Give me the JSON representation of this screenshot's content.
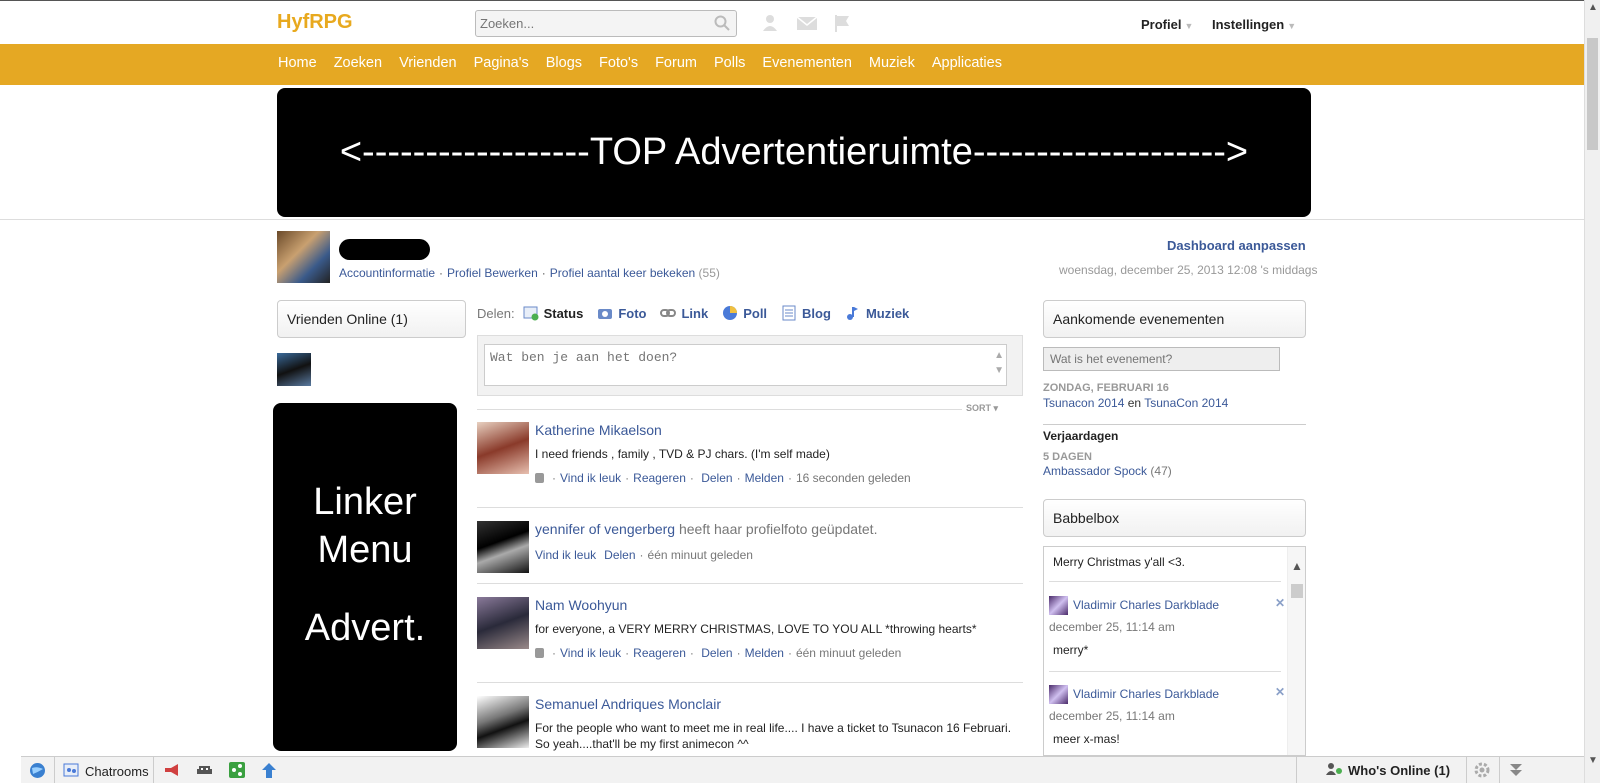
{
  "topbar": {
    "logo": "HyfRPG",
    "search_placeholder": "Zoeken...",
    "profile_label": "Profiel",
    "settings_label": "Instellingen"
  },
  "nav": {
    "items": [
      "Home",
      "Zoeken",
      "Vrienden",
      "Pagina's",
      "Blogs",
      "Foto's",
      "Forum",
      "Polls",
      "Evenementen",
      "Muziek",
      "Applicaties"
    ]
  },
  "banner": {
    "text": "<------------------TOP Advertentieruimte-------------------->"
  },
  "profile": {
    "links": [
      "Accountinformatie",
      "Profiel Bewerken",
      "Profiel aantal keer bekeken"
    ],
    "view_count": "(55)",
    "dashboard_link": "Dashboard aanpassen",
    "datetime": "woensdag, december 25, 2013 12:08 's middags"
  },
  "left": {
    "friends_header": "Vrienden Online (1)",
    "ad_line1": "Linker",
    "ad_line2": "Menu",
    "ad_line3": "Advert."
  },
  "share": {
    "label": "Delen:",
    "items": [
      "Status",
      "Foto",
      "Link",
      "Poll",
      "Blog",
      "Muziek"
    ],
    "placeholder": "Wat ben je aan het doen?",
    "sort": "SORT"
  },
  "feed": [
    {
      "author": "Katherine Mikaelson",
      "action": "",
      "text": "I need friends , family , TVD & PJ chars. (I'm self made)",
      "like": "Vind ik leuk",
      "reply": "Reageren",
      "share": "Delen",
      "report": "Melden",
      "time": "16 seconden geleden"
    },
    {
      "author": "yennifer of vengerberg",
      "action": "heeft haar profielfoto geüpdatet.",
      "like": "Vind ik leuk",
      "share": "Delen",
      "time": "één minuut geleden"
    },
    {
      "author": "Nam Woohyun",
      "action": "",
      "text": "for everyone, a VERY MERRY CHRISTMAS, LOVE TO YOU ALL *throwing hearts*",
      "like": "Vind ik leuk",
      "reply": "Reageren",
      "share": "Delen",
      "report": "Melden",
      "time": "één minuut geleden"
    },
    {
      "author": "Semanuel Andriques Monclair",
      "action": "",
      "text": "For the people who want to meet me in real life.... I have a ticket to Tsunacon 16 Februari. So yeah....that'll be my first animecon ^^"
    }
  ],
  "right": {
    "events_header": "Aankomende evenementen",
    "event_placeholder": "Wat is het evenement?",
    "event_date": "ZONDAG, FEBRUARI 16",
    "event_name1": "Tsunacon 2014",
    "event_and": "en",
    "event_name2": "TsunaCon 2014",
    "birthdays_title": "Verjaardagen",
    "birthday_when": "5 DAGEN",
    "birthday_name": "Ambassador Spock",
    "birthday_age": "(47)",
    "babbel_header": "Babbelbox",
    "babbel_first": "Merry Christmas y'all <3.",
    "messages": [
      {
        "name": "Vladimir Charles Darkblade",
        "time": "december 25, 11:14 am",
        "text": "merry*"
      },
      {
        "name": "Vladimir Charles Darkblade",
        "time": "december 25, 11:14 am",
        "text": "meer x-mas!"
      }
    ]
  },
  "bottombar": {
    "chatrooms": "Chatrooms",
    "whos_online": "Who's Online (1)"
  },
  "colors": {
    "brand": "#e5a823",
    "link": "#3b5998"
  }
}
